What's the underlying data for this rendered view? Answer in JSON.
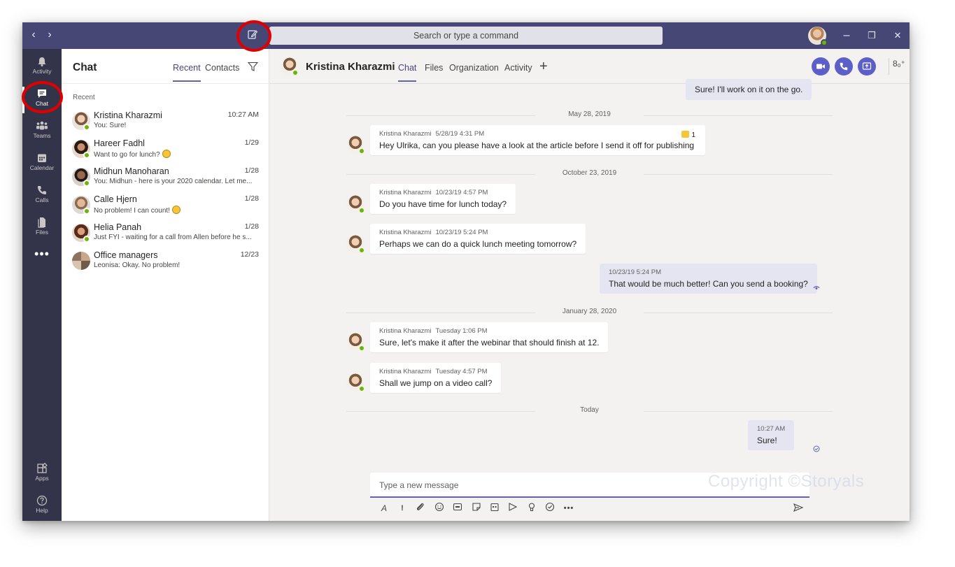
{
  "titlebar": {
    "search_placeholder": "Search or type a command",
    "back_icon": "‹",
    "forward_icon": "›",
    "minimize_icon": "–",
    "maximize_icon": "❐",
    "close_icon": "✕"
  },
  "rail": {
    "items": [
      {
        "label": "Activity",
        "icon": "bell-icon"
      },
      {
        "label": "Chat",
        "icon": "chat-icon",
        "active": true
      },
      {
        "label": "Teams",
        "icon": "teams-icon"
      },
      {
        "label": "Calendar",
        "icon": "calendar-icon"
      },
      {
        "label": "Calls",
        "icon": "phone-icon"
      },
      {
        "label": "Files",
        "icon": "files-icon"
      }
    ],
    "more": "•••",
    "bottom": [
      {
        "label": "Apps",
        "icon": "apps-icon"
      },
      {
        "label": "Help",
        "icon": "help-icon"
      }
    ]
  },
  "panel": {
    "title": "Chat",
    "tabs": [
      "Recent",
      "Contacts"
    ],
    "active_tab": "Recent",
    "section_label": "Recent",
    "chats": [
      {
        "name": "Kristina Kharazmi",
        "preview": "You: Sure!",
        "time": "10:27 AM"
      },
      {
        "name": "Hareer Fadhl",
        "preview": "Want to go for lunch?",
        "time": "1/29",
        "emoji": true
      },
      {
        "name": "Midhun Manoharan",
        "preview": "You: Midhun - here is your 2020 calendar. Let me...",
        "time": "1/28"
      },
      {
        "name": "Calle Hjern",
        "preview": "No problem! I can count!",
        "time": "1/28",
        "emoji": true
      },
      {
        "name": "Helia Panah",
        "preview": "Just FYI - waiting for a call from Allen before he s...",
        "time": "1/28"
      },
      {
        "name": "Office managers",
        "preview": "Leonisa: Okay. No problem!",
        "time": "12/23"
      }
    ]
  },
  "main": {
    "contact_name": "Kristina Kharazmi",
    "tabs": [
      "Chat",
      "Files",
      "Organization",
      "Activity"
    ],
    "active_tab": "Chat",
    "add_tab": "+",
    "people_count": "8₀⁺"
  },
  "messages": {
    "top_partial": "Sure! I'll work on it on the go.",
    "dates": [
      "May 28, 2019",
      "October 23, 2019",
      "January 28, 2020",
      "Today"
    ],
    "items": [
      {
        "author": "Kristina Kharazmi",
        "time": "5/28/19 4:31 PM",
        "text": "Hey Ulrika, can you please have a look at the article before I send it off for publishing",
        "reaction": "1"
      },
      {
        "author": "Kristina Kharazmi",
        "time": "10/23/19 4:57 PM",
        "text": "Do you have time for lunch today?"
      },
      {
        "author": "Kristina Kharazmi",
        "time": "10/23/19 5:24 PM",
        "text": "Perhaps we can do a quick lunch meeting tomorrow?"
      },
      {
        "author": "",
        "time": "10/23/19 5:24 PM",
        "text": "That would be much better! Can you send a booking?"
      },
      {
        "author": "Kristina Kharazmi",
        "time": "Tuesday 1:06 PM",
        "text": "Sure, let's make it after the webinar that should finish at 12."
      },
      {
        "author": "Kristina Kharazmi",
        "time": "Tuesday 4:57 PM",
        "text": "Shall we jump on a video call?"
      },
      {
        "author": "",
        "time": "10:27 AM",
        "text": "Sure!"
      }
    ]
  },
  "compose": {
    "placeholder": "Type a new message",
    "watermark": "Copyright ©Storyals"
  },
  "colors": {
    "titlebar": "#464775",
    "rail": "#33344a",
    "accent": "#6264a7",
    "highlight": "#e00000",
    "presence": "#6bb700"
  }
}
